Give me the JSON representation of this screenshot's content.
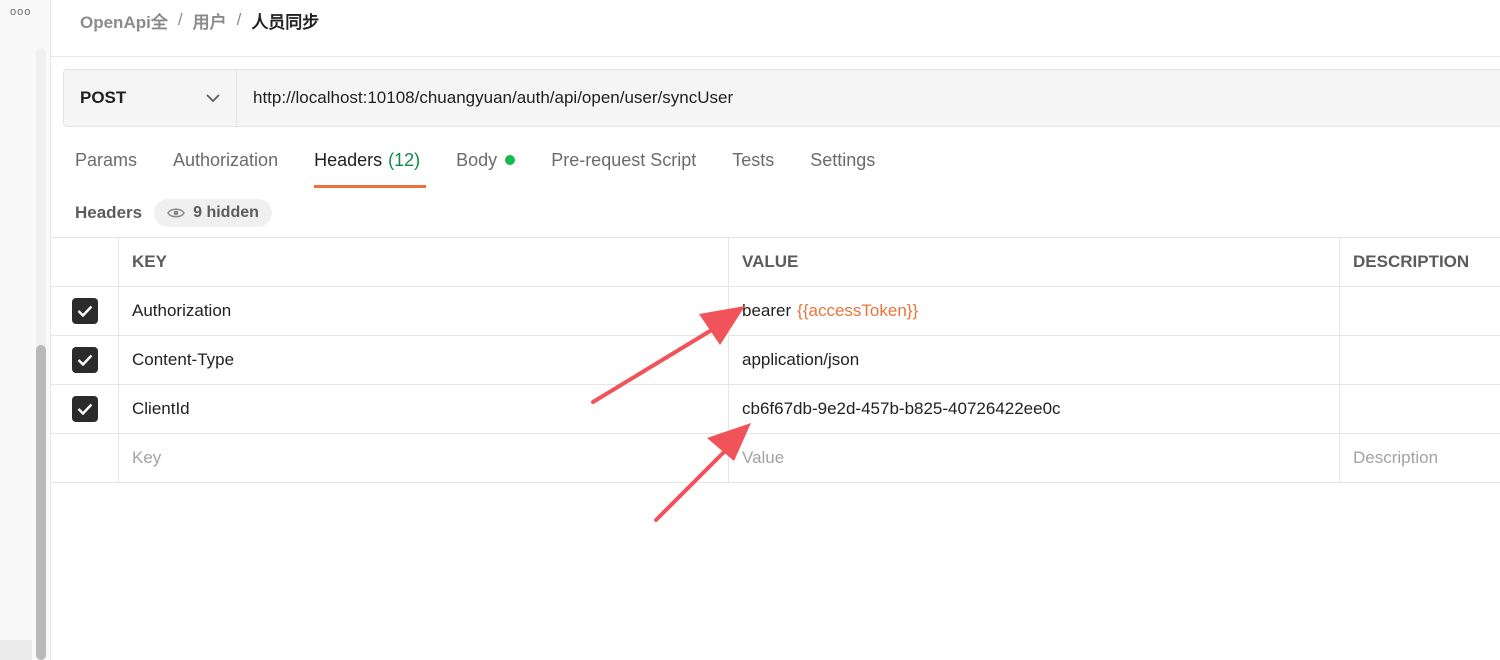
{
  "window": {
    "menu_dots": "ooo"
  },
  "breadcrumb": {
    "items": [
      "OpenApi全",
      "用户"
    ],
    "separator": "/",
    "current": "人员同步"
  },
  "request": {
    "method": "POST",
    "url": "http://localhost:10108/chuangyuan/auth/api/open/user/syncUser"
  },
  "tabs": [
    {
      "label": "Params"
    },
    {
      "label": "Authorization"
    },
    {
      "label": "Headers",
      "count": "(12)"
    },
    {
      "label": "Body"
    },
    {
      "label": "Pre-request Script"
    },
    {
      "label": "Tests"
    },
    {
      "label": "Settings"
    }
  ],
  "headers_meta": {
    "label": "Headers",
    "hidden": "9 hidden"
  },
  "table": {
    "columns": {
      "key": "KEY",
      "value": "VALUE",
      "description": "DESCRIPTION"
    },
    "rows": [
      {
        "key": "Authorization",
        "value": "bearer",
        "variable": "{{accessToken}}"
      },
      {
        "key": "Content-Type",
        "value": "application/json"
      },
      {
        "key": "ClientId",
        "value": "cb6f67db-9e2d-457b-b825-40726422ee0c"
      }
    ],
    "placeholders": {
      "key": "Key",
      "value": "Value",
      "description": "Description"
    }
  },
  "colors": {
    "accent": "#e8743b",
    "count_green": "#0d8a49",
    "body_dot": "#0fbd4a",
    "arrow": "#f0545a"
  }
}
